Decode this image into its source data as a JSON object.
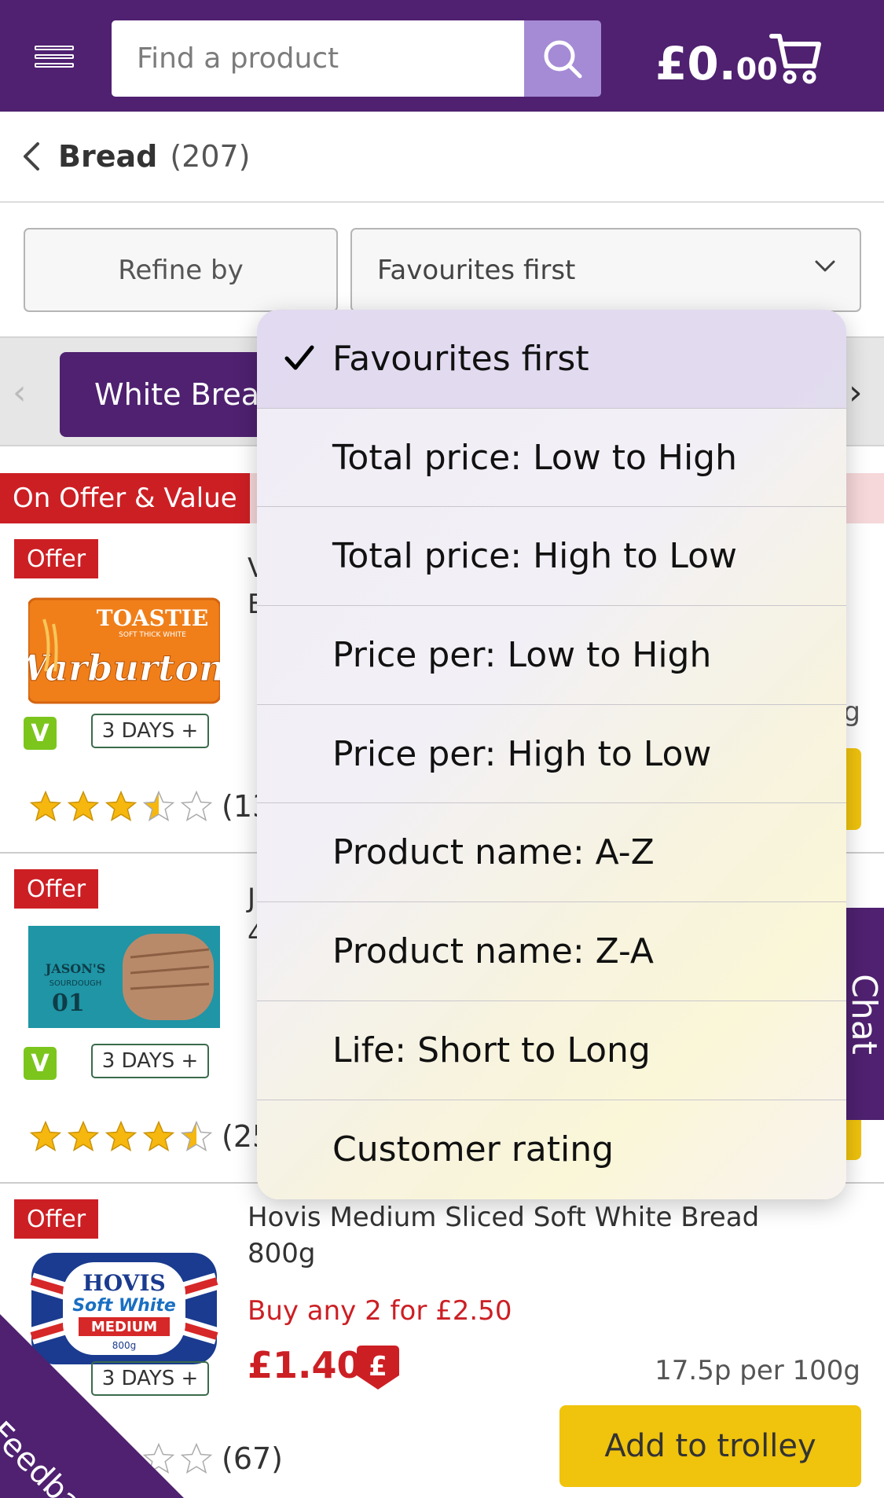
{
  "header": {
    "search_placeholder": "Find a product",
    "trolley_pounds": "£0.",
    "trolley_pence": "00",
    "brand_color": "#4f2170"
  },
  "breadcrumb": {
    "title": "Bread",
    "count": "(207)"
  },
  "filters": {
    "refine_label": "Refine by",
    "sort_label": "Favourites first"
  },
  "categories": {
    "active_chip": "White Bread"
  },
  "section": {
    "label": "On Offer & Value"
  },
  "products": [
    {
      "offer": "Offer",
      "name_fragment": "V",
      "name_fragment2": "B",
      "days": "3 DAYS",
      "rating_count": "(13",
      "rating": 3.5
    },
    {
      "offer": "Offer",
      "name_fragment": "J",
      "name_fragment2": "4",
      "days": "3 DAYS",
      "rating_count": "(25",
      "rating": 4.5
    },
    {
      "offer": "Offer",
      "name": "Hovis Medium Sliced Soft White Bread 800g",
      "promo": "Buy any 2 for £2.50",
      "price": "£1.40",
      "per_unit": "17.5p per 100g",
      "days": "3 DAYS",
      "rating_count": "(67)",
      "add_label": "Add to trolley"
    }
  ],
  "product_fragments": {
    "weight_tail": "g"
  },
  "side_tabs": {
    "chat": "Chat",
    "feedback": "Feedback"
  },
  "sort_menu": {
    "options": [
      "Favourites first",
      "Total price: Low to High",
      "Total price: High to Low",
      "Price per: Low to High",
      "Price per: High to Low",
      "Product name: A-Z",
      "Product name: Z-A",
      "Life: Short to Long",
      "Customer rating"
    ],
    "selected_index": 0
  }
}
